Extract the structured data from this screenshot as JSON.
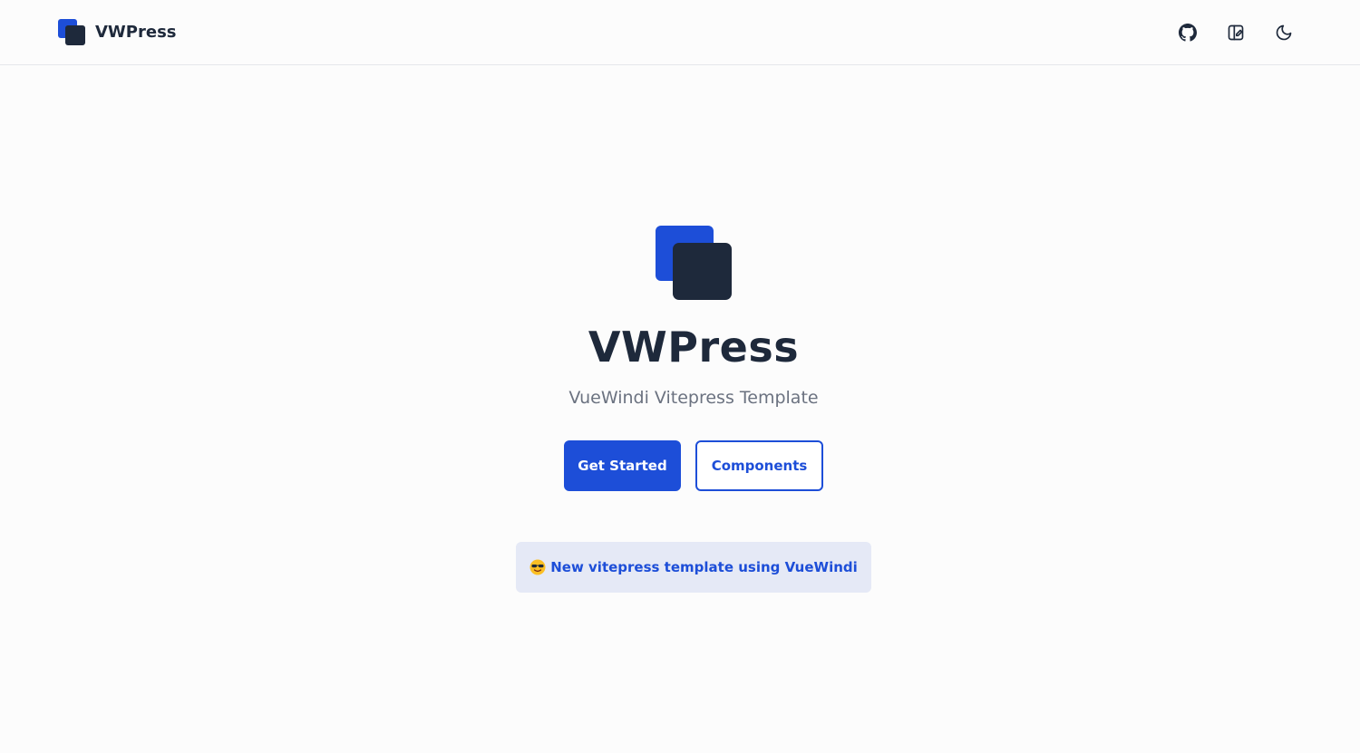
{
  "navbar": {
    "brand_name": "VWPress",
    "icons": [
      "github-icon",
      "layout-icon",
      "moon-icon"
    ]
  },
  "hero": {
    "title": "VWPress",
    "subtitle": "VueWindi Vitepress Template",
    "primary_button_label": "Get Started",
    "secondary_button_label": "Components",
    "announcement_icon": "sunglasses-emoji-icon",
    "announcement_text": "New vitepress template using VueWindi"
  },
  "colors": {
    "primary": "#1d4ed8",
    "dark": "#1e293b",
    "muted": "#6b7280",
    "announcement_bg": "#e5e9f6",
    "page_bg": "#fcfcfc"
  }
}
